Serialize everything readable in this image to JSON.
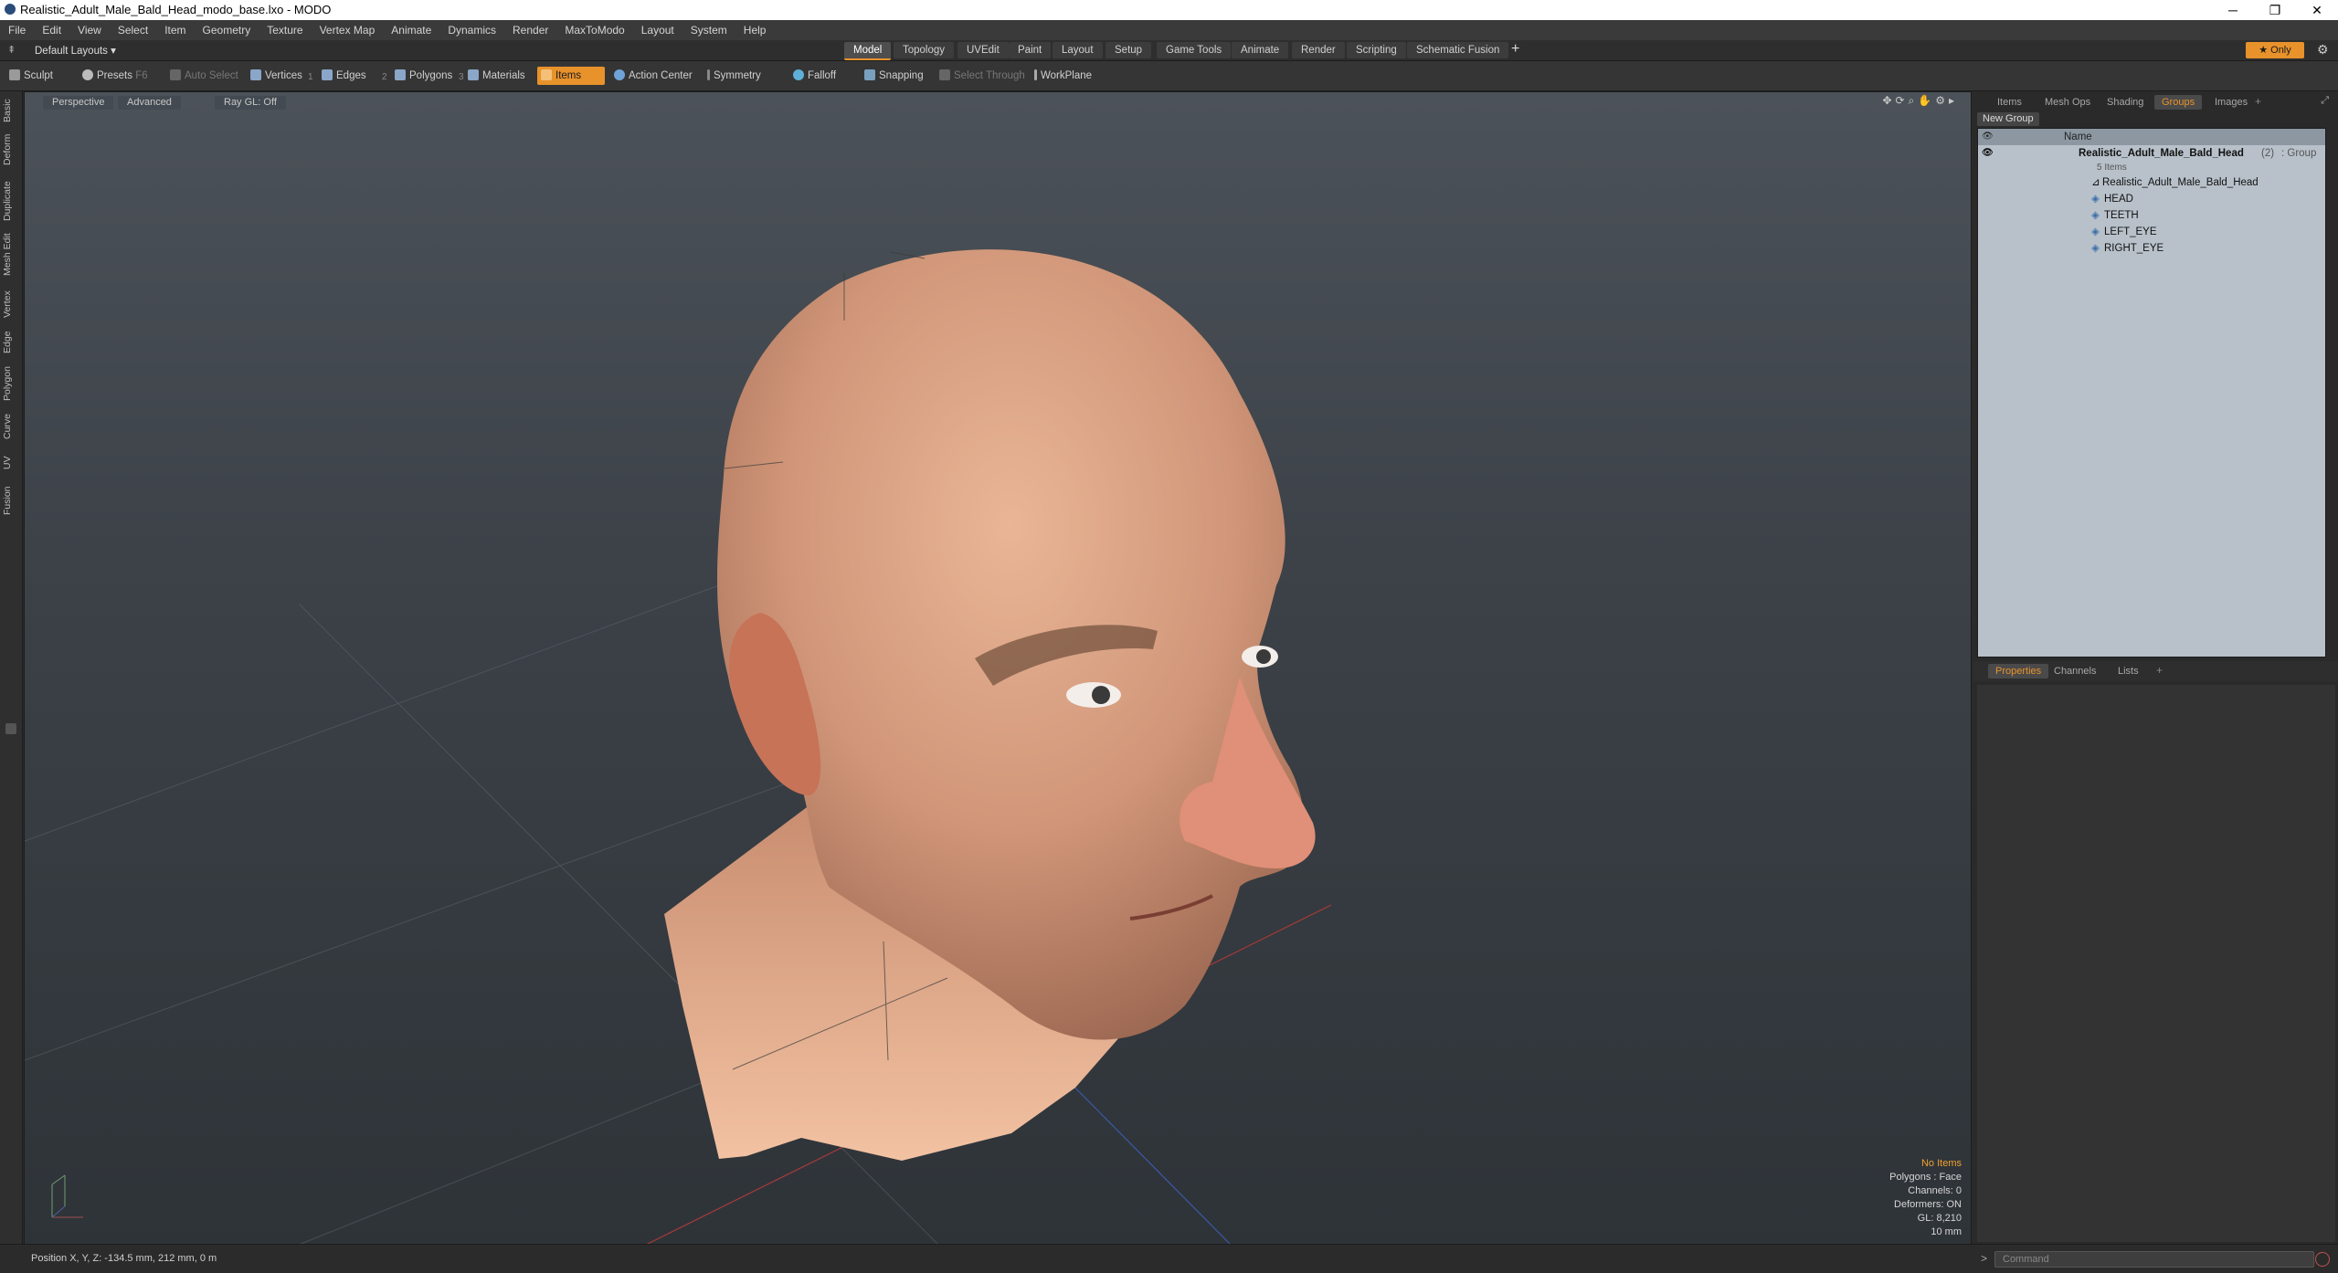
{
  "window": {
    "title": "Realistic_Adult_Male_Bald_Head_modo_base.lxo - MODO",
    "minimize": "─",
    "maximize": "❐",
    "close": "✕"
  },
  "menu": [
    "File",
    "Edit",
    "View",
    "Select",
    "Item",
    "Geometry",
    "Texture",
    "Vertex Map",
    "Animate",
    "Dynamics",
    "Render",
    "MaxToModo",
    "Layout",
    "System",
    "Help"
  ],
  "layouts": {
    "dropdown": "Default Layouts ▾",
    "tabs": [
      "Model",
      "Topology",
      "UVEdit",
      "Paint",
      "Layout",
      "Setup",
      "Game Tools",
      "Animate",
      "Render",
      "Scripting",
      "Schematic Fusion"
    ],
    "active_tab": "Model",
    "add": "+",
    "only": "★  Only"
  },
  "toolbar": {
    "sculpt": "Sculpt",
    "presets": "Presets",
    "presets_key": "F6",
    "auto_select": "Auto Select",
    "vertices": "Vertices",
    "edges": "Edges",
    "polygons": "Polygons",
    "materials": "Materials",
    "items": "Items",
    "action_center": "Action Center",
    "symmetry": "Symmetry",
    "falloff": "Falloff",
    "snapping": "Snapping",
    "select_through": "Select Through",
    "workplane": "WorkPlane",
    "num1": "1",
    "num2": "2",
    "num3": "3"
  },
  "left_tabs": [
    "Basic",
    "Deform",
    "Duplicate",
    "Mesh Edit",
    "Vertex",
    "Edge",
    "Polygon",
    "Curve",
    "UV",
    "Fusion"
  ],
  "viewport": {
    "view": "Perspective",
    "shading": "Advanced",
    "raygl": "Ray GL: Off",
    "info": {
      "selection": "No Items",
      "polygons": "Polygons : Face",
      "channels": "Channels: 0",
      "deformers": "Deformers: ON",
      "gl": "GL: 8,210",
      "scale": "10 mm"
    }
  },
  "right_panel": {
    "tabs": [
      "Items",
      "Mesh Ops",
      "Shading",
      "Groups",
      "Images"
    ],
    "active_tab": "Groups",
    "new_group": "New Group",
    "name_header": "Name",
    "group": {
      "name": "Realistic_Adult_Male_Bald_Head",
      "count": "(2)",
      "type": ": Group",
      "items_count": "5 Items"
    },
    "children": [
      "Realistic_Adult_Male_Bald_Head",
      "HEAD",
      "TEETH",
      "LEFT_EYE",
      "RIGHT_EYE"
    ],
    "lower_tabs": [
      "Properties",
      "Channels",
      "Lists"
    ],
    "lower_active": "Properties"
  },
  "status": {
    "position": "Position X, Y, Z:   -134.5 mm, 212 mm, 0 m",
    "command_placeholder": "Command",
    "prompt": ">"
  },
  "colors": {
    "accent": "#e8922b",
    "viewport_top": "#4c5259",
    "viewport_bottom": "#2e3338",
    "list_bg": "#b8c1ca"
  }
}
